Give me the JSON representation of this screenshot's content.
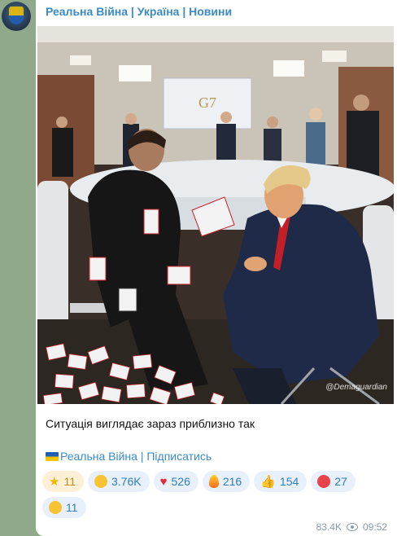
{
  "channel": {
    "name": "Реальна Війна | Україна | Новини"
  },
  "post": {
    "caption": "Ситуація виглядає зараз приблизно так",
    "subscribe_text": "Реальна Війна | Підписатись",
    "photo_watermark": "@Demaguardian",
    "screen_text": "G7"
  },
  "reactions": [
    {
      "icon": "star-icon",
      "count": "11"
    },
    {
      "icon": "grin-emoji-icon",
      "count": "3.76K"
    },
    {
      "icon": "heart-icon",
      "count": "526"
    },
    {
      "icon": "fire-icon",
      "count": "216"
    },
    {
      "icon": "thumbs-up-icon",
      "count": "154"
    },
    {
      "icon": "angry-face-icon",
      "count": "27"
    },
    {
      "icon": "crying-face-icon",
      "count": "11"
    }
  ],
  "meta": {
    "views": "83.4K",
    "time": "09:52"
  },
  "colors": {
    "accent": "#3a8bc8",
    "background": "#8fa98a",
    "bubble": "#ffffff"
  }
}
